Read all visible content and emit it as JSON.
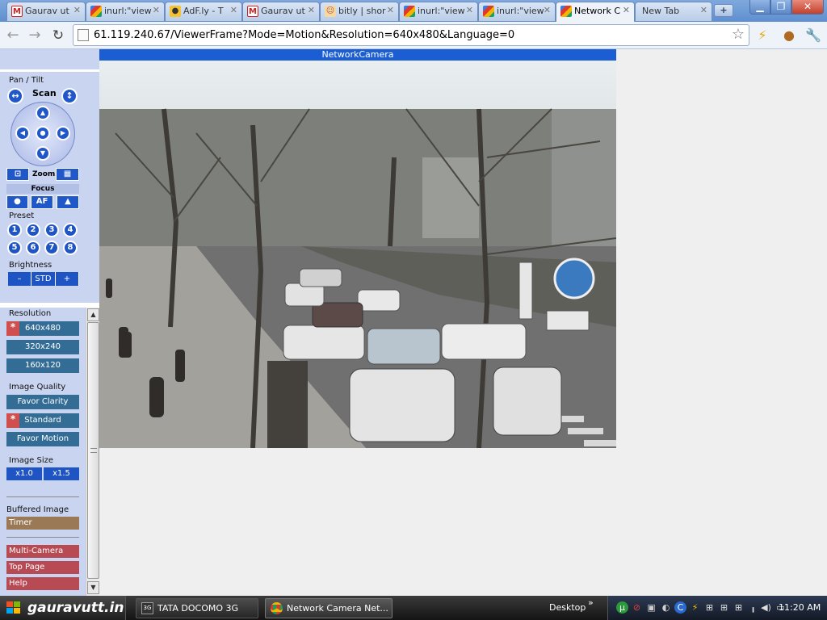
{
  "browser": {
    "tabs": [
      {
        "title": "Gaurav ut",
        "icon": "gmail-icon"
      },
      {
        "title": "inurl:\"view",
        "icon": "google-icon"
      },
      {
        "title": "AdF.ly - T",
        "icon": "bee-icon"
      },
      {
        "title": "Gaurav ut",
        "icon": "gmail-icon"
      },
      {
        "title": "bitly | shor",
        "icon": "bitly-icon"
      },
      {
        "title": "inurl:\"view",
        "icon": "google-icon"
      },
      {
        "title": "inurl:\"view",
        "icon": "google-icon"
      },
      {
        "title": "Network C",
        "icon": "google-icon",
        "active": true
      },
      {
        "title": "New Tab",
        "icon": ""
      }
    ],
    "new_tab_label": "+",
    "url": "61.119.240.67/ViewerFrame?Mode=Motion&Resolution=640x480&Language=0"
  },
  "page": {
    "camera_title": "NetworkCamera",
    "pan_tilt": {
      "label": "Pan / Tilt",
      "scan_label": "Scan"
    },
    "zoom_label": "Zoom",
    "focus": {
      "label": "Focus",
      "af_label": "AF"
    },
    "preset": {
      "label": "Preset",
      "buttons": [
        "1",
        "2",
        "3",
        "4",
        "5",
        "6",
        "7",
        "8"
      ]
    },
    "brightness": {
      "label": "Brightness",
      "minus": "–",
      "std": "STD",
      "plus": "+"
    },
    "resolution": {
      "label": "Resolution",
      "options": [
        "640x480",
        "320x240",
        "160x120"
      ],
      "selected": "640x480"
    },
    "image_quality": {
      "label": "Image Quality",
      "options": [
        "Favor Clarity",
        "Standard",
        "Favor Motion"
      ],
      "selected": "Standard"
    },
    "image_size": {
      "label": "Image Size",
      "options": [
        "x1.0",
        "x1.5"
      ]
    },
    "buffered_image": {
      "label": "Buffered Image",
      "timer": "Timer"
    },
    "links": [
      "Multi-Camera",
      "Top Page",
      "Help"
    ],
    "selected_mark": "*",
    "colors": {
      "panel_bg": "#c9d4f0",
      "ptz_blue": "#2057c9",
      "option_blue": "#336d96",
      "selected_red": "#cf4f4f",
      "timer_brown": "#9a7a56",
      "link_red": "#b84a54",
      "camera_header": "#1b5ed4"
    }
  },
  "taskbar": {
    "start_label": "gauravutt.in",
    "items": [
      {
        "label": "TATA DOCOMO 3G",
        "icon": "3g-icon"
      },
      {
        "label": "Network Camera Net...",
        "icon": "chrome-icon",
        "active": true
      }
    ],
    "desktop_label": "Desktop",
    "clock": "11:20 AM"
  }
}
